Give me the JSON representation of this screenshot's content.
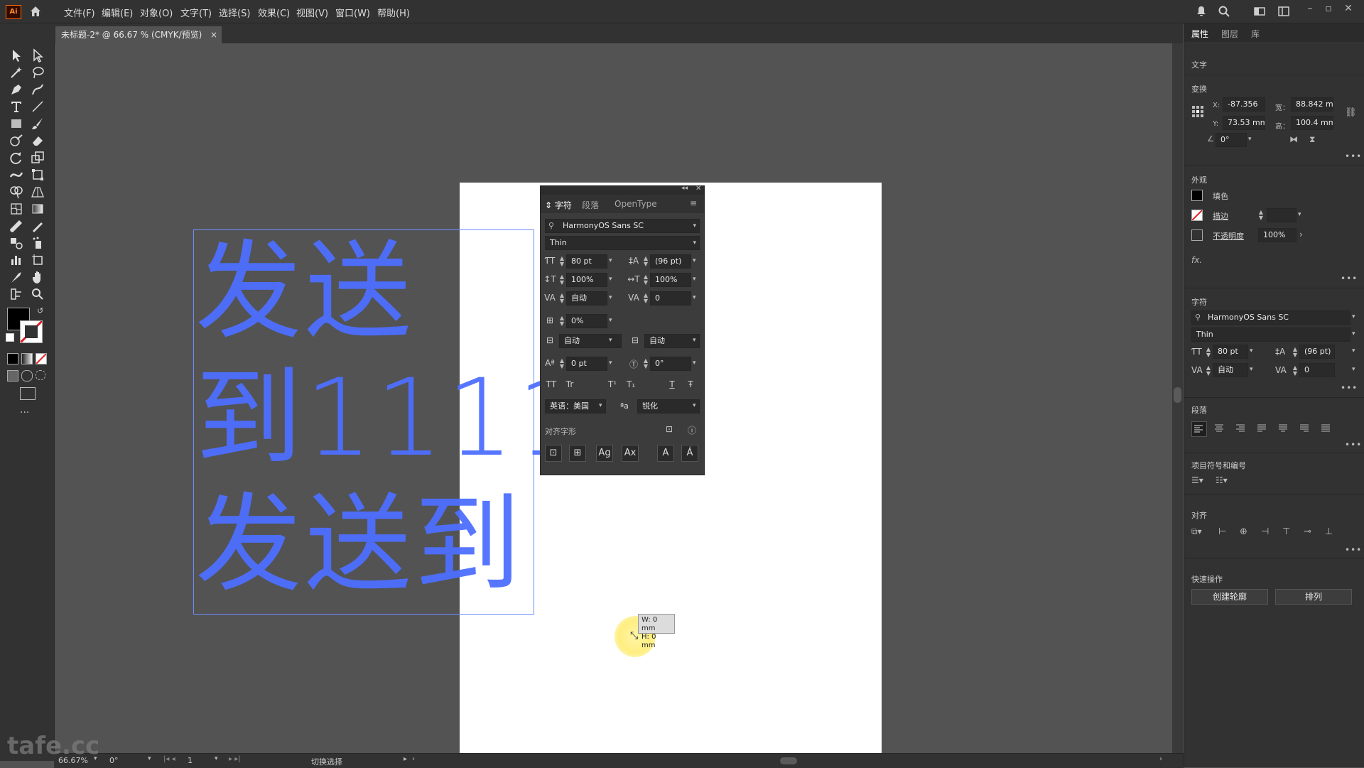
{
  "app": {
    "logo": "Ai",
    "menu": [
      "文件(F)",
      "编辑(E)",
      "对象(O)",
      "文字(T)",
      "选择(S)",
      "效果(C)",
      "视图(V)",
      "窗口(W)",
      "帮助(H)"
    ],
    "icons": [
      "home-icon",
      "bell-icon",
      "search-icon",
      "workspace-icon",
      "arrange-icon"
    ]
  },
  "tab": {
    "title": "未标题-2* @ 66.67 % (CMYK/预览)",
    "close": "×"
  },
  "canvas": {
    "lines": [
      "发送",
      "到1111",
      "发送到"
    ],
    "text_color": "#4d6fff"
  },
  "tooltip": {
    "w": "W: 0 mm",
    "h": "H: 0 mm"
  },
  "char_panel": {
    "tabs": [
      "字符",
      "段落",
      "OpenType"
    ],
    "font_family": "HarmonyOS Sans SC",
    "font_style": "Thin",
    "size": "80 pt",
    "leading": "(96 pt)",
    "vscale": "100%",
    "hscale": "100%",
    "kerning": "自动",
    "tracking": "0",
    "tsume": "0%",
    "aki_left": "自动",
    "aki_right": "自动",
    "baseline": "0 pt",
    "rotation": "0°",
    "style_buttons": [
      "TT",
      "Tr",
      "T¹",
      "T₁",
      "T",
      "Ŧ"
    ],
    "language": "英语：美国",
    "aa_label": "ªa",
    "antialias": "锐化",
    "snap_label": "对齐字形",
    "snap_buttons": [
      "⊡",
      "⊞",
      "Ag",
      "Ax",
      "A",
      "Á"
    ]
  },
  "properties": {
    "tabs": [
      "属性",
      "图层",
      "库"
    ],
    "type_label": "文字",
    "transform": {
      "title": "变换",
      "x_label": "X:",
      "x": "-87.356",
      "y_label": "Y:",
      "y": "73.53 mm",
      "w_label": "宽：",
      "w": "88.842 m",
      "h_label": "高：",
      "h": "100.4 mm",
      "angle": "0°"
    },
    "appearance": {
      "title": "外观",
      "fill": "填色",
      "stroke": "描边",
      "opacity_label": "不透明度",
      "opacity": "100%",
      "fx": "fx."
    },
    "character": {
      "title": "字符",
      "font_family": "HarmonyOS Sans SC",
      "font_style": "Thin",
      "size": "80 pt",
      "leading": "(96 pt)",
      "kerning": "自动",
      "tracking": "0"
    },
    "paragraph": {
      "title": "段落"
    },
    "bullets": {
      "title": "项目符号和编号"
    },
    "align": {
      "title": "对齐"
    },
    "quick": {
      "title": "快速操作",
      "outline": "创建轮廓",
      "arrange": "排列"
    }
  },
  "status": {
    "zoom": "66.67%",
    "rotate": "0°",
    "artboard": "1",
    "tool": "切换选择"
  },
  "watermark": "tafe.cc"
}
